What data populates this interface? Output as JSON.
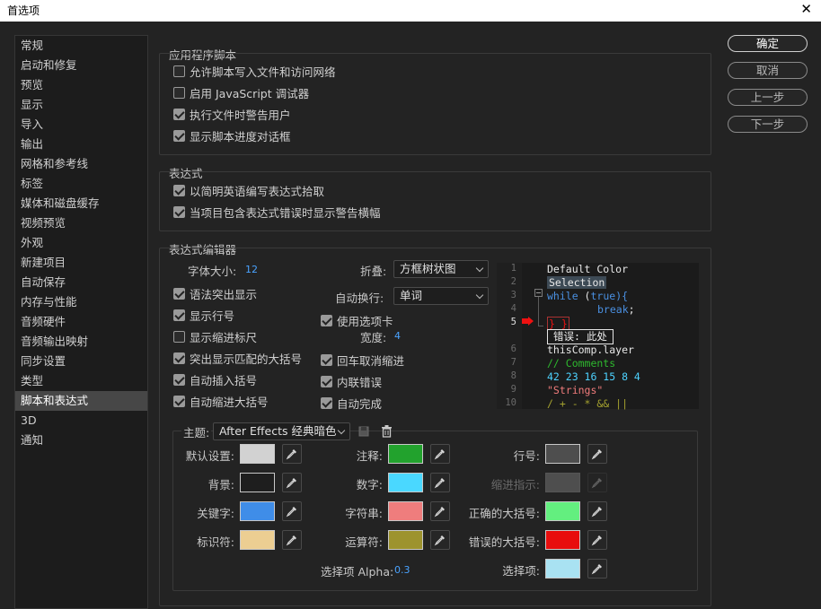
{
  "window": {
    "title": "首选项",
    "close_glyph": "✕"
  },
  "sidebar": {
    "items": [
      {
        "label": "常规"
      },
      {
        "label": "启动和修复"
      },
      {
        "label": "预览"
      },
      {
        "label": "显示"
      },
      {
        "label": "导入"
      },
      {
        "label": "输出"
      },
      {
        "label": "网格和参考线"
      },
      {
        "label": "标签"
      },
      {
        "label": "媒体和磁盘缓存"
      },
      {
        "label": "视频预览"
      },
      {
        "label": "外观"
      },
      {
        "label": "新建项目"
      },
      {
        "label": "自动保存"
      },
      {
        "label": "内存与性能"
      },
      {
        "label": "音频硬件"
      },
      {
        "label": "音频输出映射"
      },
      {
        "label": "同步设置"
      },
      {
        "label": "类型"
      },
      {
        "label": "脚本和表达式",
        "selected": true
      },
      {
        "label": "3D"
      },
      {
        "label": "通知"
      }
    ]
  },
  "buttons": {
    "ok": "确定",
    "cancel": "取消",
    "prev": "上一步",
    "next": "下一步"
  },
  "app_scripts": {
    "title": "应用程序脚本",
    "options": [
      {
        "label": "允许脚本写入文件和访问网络",
        "checked": false
      },
      {
        "label": "启用 JavaScript 调试器",
        "checked": false
      },
      {
        "label": "执行文件时警告用户",
        "checked": true
      },
      {
        "label": "显示脚本进度对话框",
        "checked": true
      }
    ]
  },
  "expressions": {
    "title": "表达式",
    "options": [
      {
        "label": "以简明英语编写表达式拾取",
        "checked": true
      },
      {
        "label": "当项目包含表达式错误时显示警告横幅",
        "checked": true
      }
    ]
  },
  "editor": {
    "title": "表达式编辑器",
    "font_size_label": "字体大小:",
    "font_size_value": "12",
    "fold_label": "折叠:",
    "fold_value": "方框树状图",
    "autowrap_label": "自动换行:",
    "autowrap_value": "单词",
    "tab_width_label": "宽度:",
    "tab_width_value": "4",
    "left_options": [
      {
        "label": "语法突出显示",
        "checked": true
      },
      {
        "label": "显示行号",
        "checked": true
      },
      {
        "label": "显示缩进标尺",
        "checked": false
      },
      {
        "label": "突出显示匹配的大括号",
        "checked": true
      },
      {
        "label": "自动插入括号",
        "checked": true
      },
      {
        "label": "自动缩进大括号",
        "checked": true
      }
    ],
    "use_tabs": {
      "label": "使用选项卡",
      "checked": true
    },
    "right_options": [
      {
        "label": "回车取消缩进",
        "checked": true
      },
      {
        "label": "内联错误",
        "checked": true
      },
      {
        "label": "自动完成",
        "checked": true
      }
    ]
  },
  "preview": {
    "line_numbers": [
      "1",
      "2",
      "3",
      "4",
      "5",
      "6",
      "7",
      "8",
      "9",
      "10"
    ],
    "lines": {
      "l1": "Default Color",
      "l2": "Selection",
      "l3a": "while",
      "l3b": " (",
      "l3c": "true",
      "l3d": "){",
      "l4": "break",
      "l4b": ";",
      "l5": "} }",
      "l5_error": "错误: 此处",
      "l6": "thisComp.layer",
      "l7": "// Comments",
      "l8": "42 23 16 15 8 4",
      "l9": "\"Strings\"",
      "l10": "/ + - * && ||"
    },
    "colors": {
      "default": "#e8e8e8",
      "selection_bg": "#3d4a55",
      "keyword": "#4a90e2",
      "comment": "#2eb82e",
      "number": "#4dd2ff",
      "string": "#ef7b7b",
      "operator": "#a4a12f",
      "error": "#ee1111"
    }
  },
  "theme": {
    "label": "主题:",
    "value": "After Effects 经典暗色",
    "swatches": {
      "default": {
        "label": "默认设置:",
        "color": "#d2d2d2"
      },
      "background": {
        "label": "背景:",
        "color": "#1e1e1e"
      },
      "keyword": {
        "label": "关键字:",
        "color": "#3f8de8"
      },
      "identifier": {
        "label": "标识符:",
        "color": "#ecce92"
      },
      "comment": {
        "label": "注释:",
        "color": "#22a22d"
      },
      "number": {
        "label": "数字:",
        "color": "#4ad8ff"
      },
      "string": {
        "label": "字符串:",
        "color": "#ef7d7d"
      },
      "operator": {
        "label": "运算符:",
        "color": "#9d932e"
      },
      "line_number": {
        "label": "行号:",
        "color": "#4e4e4e"
      },
      "indent_guide": {
        "label": "缩进指示:",
        "color": "#4e4e4e",
        "disabled": true
      },
      "brace_ok": {
        "label": "正确的大括号:",
        "color": "#63ef7f"
      },
      "brace_bad": {
        "label": "错误的大括号:",
        "color": "#e80d0d"
      },
      "selection": {
        "label": "选择项:",
        "color": "#a9e2f2"
      }
    },
    "selection_alpha_label": "选择项 Alpha:",
    "selection_alpha_value": "0.3"
  }
}
